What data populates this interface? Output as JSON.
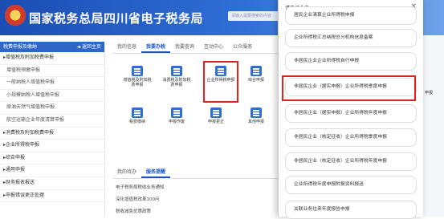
{
  "header": {
    "title": "国家税务总局四川省电子税务局",
    "search_placeholder": "请输入需要搜索的内容"
  },
  "sidebar": {
    "title": "税费申报及缴纳",
    "back": "◄ 返回主页",
    "items": [
      {
        "label": "▸增值税及附加税费申报"
      },
      {
        "label": "增值税预缴申报"
      },
      {
        "label": "一般纳税人增值税申报"
      },
      {
        "label": "小规模纳税人增值税申报"
      },
      {
        "label": "原油天然气增值税申报"
      },
      {
        "label": "航空运输企业年度清算申报"
      },
      {
        "label": "▸消费税及附加税费申报"
      },
      {
        "label": "▸企业所得税申报"
      },
      {
        "label": "▸综合申报"
      },
      {
        "label": "▸通用申报"
      },
      {
        "label": "▸财务报表报送"
      },
      {
        "label": "▸申报错误更正处理"
      }
    ]
  },
  "main": {
    "tabs": [
      {
        "label": "我的信息"
      },
      {
        "label": "我要办税"
      },
      {
        "label": "我要查询"
      },
      {
        "label": "互动中心"
      },
      {
        "label": "公众服务"
      }
    ],
    "icons": [
      {
        "label": "增值税及附加税费申报"
      },
      {
        "label": "消费税及附加税费申报"
      },
      {
        "label": "企业所得税申报"
      },
      {
        "label": "综合申报"
      },
      {
        "label": "税费缴纳"
      },
      {
        "label": "申报作废"
      },
      {
        "label": "申报更正"
      },
      {
        "label": "其他申报"
      }
    ],
    "todo_tabs": [
      {
        "label": "我的待办"
      },
      {
        "label": "服务提醒"
      }
    ],
    "todo_lines": [
      {
        "text": "电子税务局税收业务通知"
      },
      {
        "text": "深化增值税改革100问"
      },
      {
        "text": "税收减免优惠政策"
      }
    ]
  },
  "right_edge": {
    "label": "申报"
  },
  "modal": {
    "title": "请选择业务",
    "close": "×",
    "options": [
      {
        "label": "居民企业清算企业所得税申报"
      },
      {
        "label": "企业所得税汇总纳税总分机构信息备案"
      },
      {
        "label": "非居民企业企业所得税自行申报"
      },
      {
        "label": "非居民企业（据实申报）企业所得税季度申报"
      },
      {
        "label": "非居民企业（据实申报）企业所得税年度申报"
      },
      {
        "label": "非居民企业（核定征收）企业所得税季度申报"
      },
      {
        "label": "非居民企业（核定征收）企业所得税年度申报"
      },
      {
        "label": "企业所得税年度申报附报资料报送"
      },
      {
        "label": "关联业务往来年度报告申报"
      }
    ]
  }
}
